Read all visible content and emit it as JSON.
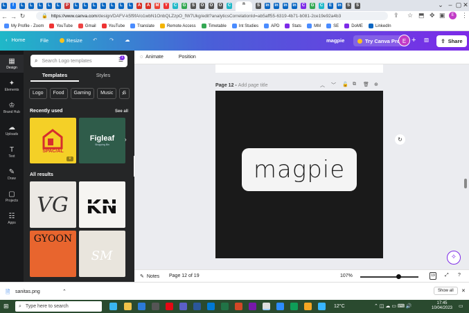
{
  "browser": {
    "tabs": [
      "L",
      "f",
      "L",
      "L",
      "L",
      "L",
      "L",
      "P",
      "L",
      "L",
      "L",
      "L",
      "L",
      "L",
      "L",
      "A",
      "A",
      "M",
      "Y",
      "C",
      "G",
      "S",
      "O",
      "O",
      "O",
      "C",
      "n",
      "S",
      "in",
      "in",
      "in",
      "in",
      "C",
      "G",
      "C",
      "E",
      "in",
      "S",
      "S"
    ],
    "active_tab_label": "n",
    "url_domain": "https://www.canva.com",
    "url_path": "/design/DAFV-k5f9fA/o1wbN1OnbQLZzpO_fW7Ukg/edit?analyticsCorrelationId=ab5aff55-6319-4b71-b081-2ce19e92a4b3",
    "bookmarks": [
      "My Profile - Zoom",
      "YouTube",
      "Gmail",
      "YouTube",
      "Translate",
      "Remote Access",
      "Timetable",
      "Int Studies",
      "APD",
      "Stats",
      "MM",
      "SE",
      "DoME",
      "LinkedIn"
    ],
    "bookmark_colors": [
      "#4a8cff",
      "#e33",
      "#e44",
      "#e33",
      "#4a8cff",
      "#f4b400",
      "#34a853",
      "#4a8cff",
      "#4a8cff",
      "#7d2ae8",
      "#4a8cff",
      "#4a8cff",
      "#7d2ae8",
      "#0a66c2"
    ]
  },
  "header": {
    "home": "Home",
    "file": "File",
    "resize": "Resize",
    "design_name": "magpie",
    "try_pro": "Try Canva Pro",
    "avatar_letter": "E",
    "share": "Share"
  },
  "rail": [
    {
      "label": "Design",
      "icon": "design-icon",
      "glyph": "▦"
    },
    {
      "label": "Elements",
      "icon": "elements-icon",
      "glyph": "✦"
    },
    {
      "label": "Brand Hub",
      "icon": "brand-icon",
      "glyph": "♔"
    },
    {
      "label": "Uploads",
      "icon": "uploads-icon",
      "glyph": "☁"
    },
    {
      "label": "Text",
      "icon": "text-icon",
      "glyph": "T"
    },
    {
      "label": "Draw",
      "icon": "draw-icon",
      "glyph": "✎"
    },
    {
      "label": "Projects",
      "icon": "projects-icon",
      "glyph": "▢"
    },
    {
      "label": "Apps",
      "icon": "apps-icon",
      "glyph": "☷"
    }
  ],
  "panel": {
    "search_placeholder": "Search Logo templates",
    "filter_badge": "1",
    "tabs": [
      "Templates",
      "Styles"
    ],
    "chips": [
      "Logo",
      "Food",
      "Gaming",
      "Music",
      "S"
    ],
    "recently_used": "Recently used",
    "see_all": "See all",
    "recent": [
      {
        "title": "SPAC/AL",
        "bg": "#f4d027"
      },
      {
        "title": "Figleaf",
        "subtitle": "Shopping Bin",
        "bg": "#2f5c4a"
      }
    ],
    "all_results": "All results",
    "results": [
      {
        "text": "VG",
        "bg": "#ece9e4"
      },
      {
        "text": "KN",
        "bg": "#f6f5f2"
      },
      {
        "text": "GYOON",
        "bg": "#e8652e"
      },
      {
        "text": "SM",
        "bg": "#e9e5dd"
      }
    ]
  },
  "editor": {
    "animate": "Animate",
    "position": "Position",
    "page_label": "Page 12 - ",
    "page_title_placeholder": "Add page title",
    "logo_text": "magpie",
    "notes": "Notes",
    "page_count": "Page 12 of 19",
    "zoom": "107%",
    "zoom_level": 0.65,
    "grid_count": "19"
  },
  "download": {
    "file": "sanitas.png",
    "show_all": "Show all"
  },
  "taskbar": {
    "search_placeholder": "Type here to search",
    "weather": "12°C",
    "time": "17:45",
    "date": "10/04/2023"
  }
}
